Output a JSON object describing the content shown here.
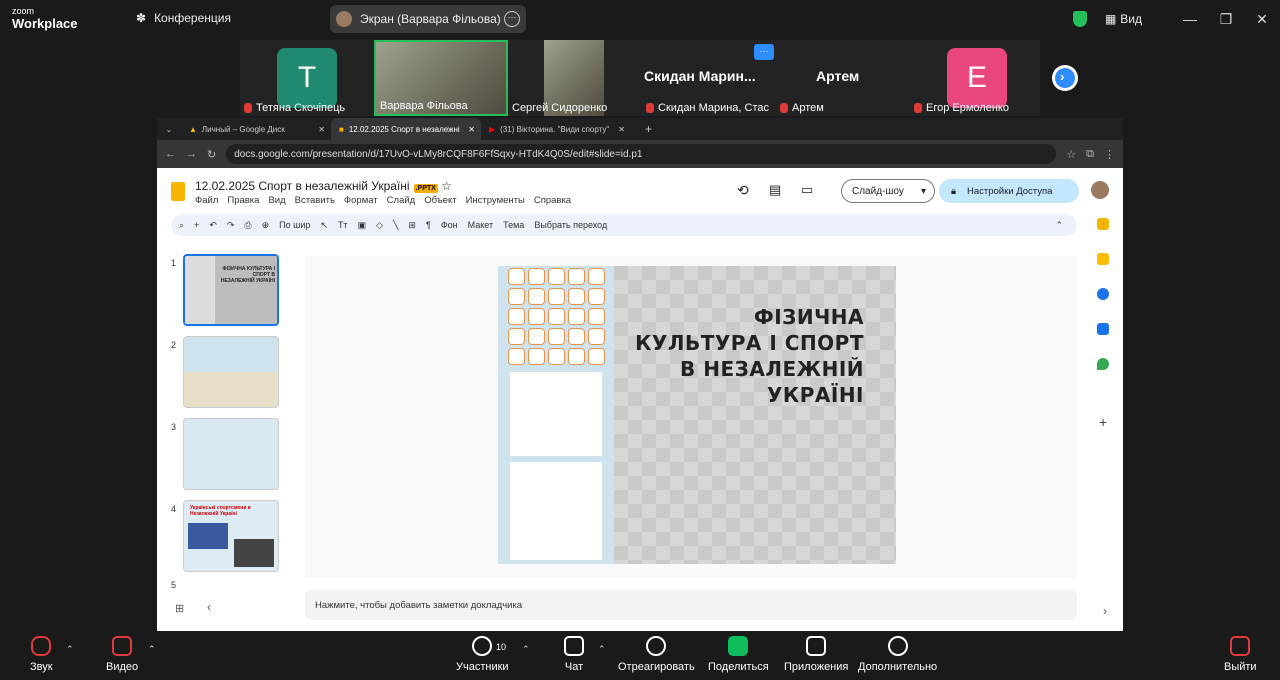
{
  "app": {
    "brand_top": "zoom",
    "brand": "Workplace",
    "meeting_label": "Конференция",
    "share_label": "Экран (Варвара Фільова)",
    "view_label": "Вид"
  },
  "participants": [
    {
      "name": "Тетяна Скочіпець",
      "initial": "T",
      "color": "#1f8a70"
    },
    {
      "name": "Варвара Фільова"
    },
    {
      "name": "Сергей Сидоренко"
    },
    {
      "name": "Скидан Марина, Стас",
      "display": "Скидан Марин..."
    },
    {
      "name": "Артем",
      "display": "Артем"
    },
    {
      "name": "Егор Ермоленко",
      "initial": "E",
      "color": "#e8467c"
    }
  ],
  "browser": {
    "tabs": [
      "Личный – Google Диск",
      "12.02.2025 Спорт в незалежні",
      "(31) Вікторина. \"Види спорту\""
    ],
    "url": "docs.google.com/presentation/d/17UvO-vLMy8rCQF8F6FfSqxy-HTdK4Q0S/edit#slide=id.p1"
  },
  "slides": {
    "title": "12.02.2025  Спорт в незалежній Україні",
    "badge": ".PPTX",
    "menu": [
      "Файл",
      "Правка",
      "Вид",
      "Вставить",
      "Формат",
      "Слайд",
      "Объект",
      "Инструменты",
      "Справка"
    ],
    "slideshow": "Слайд-шоу",
    "access": "Настройки Доступа",
    "toolbar": [
      "По шир",
      "Фон",
      "Макет",
      "Тема",
      "Выбрать переход"
    ],
    "thumb_numbers": [
      "1",
      "2",
      "3",
      "4",
      "5"
    ],
    "thumb1_title": "ФІЗИЧНА КУЛЬТУРА І СПОРТ В НЕЗАЛЕЖНІЙ УКРАЇНІ",
    "thumb4_title": "Українські спортсмени в Незалежній Україні",
    "slide_title_lines": [
      "ФІЗИЧНА",
      "КУЛЬТУРА І СПОРТ",
      "В НЕЗАЛЕЖНІЙ",
      "УКРАЇНІ"
    ],
    "notes_placeholder": "Нажмите, чтобы добавить заметки докладчика"
  },
  "controls": {
    "audio": "Звук",
    "video": "Видео",
    "participants": "Участники",
    "participants_count": "10",
    "chat": "Чат",
    "react": "Отреагировать",
    "share": "Поделиться",
    "apps": "Приложения",
    "more": "Дополнительно",
    "leave": "Выйти"
  },
  "colors": {
    "zoom_blue": "#2d8cff",
    "share_green": "#0fbd5d",
    "google_yellow": "#f5b400",
    "selected_blue": "#1a73e8"
  }
}
